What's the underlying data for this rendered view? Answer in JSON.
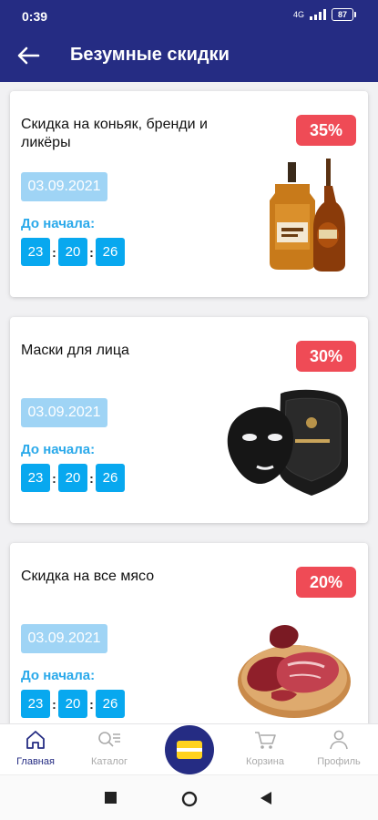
{
  "status": {
    "time": "0:39",
    "network": "4G",
    "battery": "87"
  },
  "header": {
    "title": "Безумные скидки"
  },
  "colors": {
    "primary": "#252c83",
    "badge": "#ef4b56",
    "timer": "#08a8ef",
    "date_bg": "#9fd4f5"
  },
  "cards": [
    {
      "name": "Скидка на коньяк, бренди и ликёры",
      "discount": "35%",
      "date": "03.09.2021",
      "countdown_label": "До начала:",
      "hours": "23",
      "minutes": "20",
      "seconds": "26",
      "image": "cognac-bottles-image"
    },
    {
      "name": "Маски для лица",
      "discount": "30%",
      "date": "03.09.2021",
      "countdown_label": "До начала:",
      "hours": "23",
      "minutes": "20",
      "seconds": "26",
      "image": "black-face-mask-image"
    },
    {
      "name": "Скидка на все мясо",
      "discount": "20%",
      "date": "03.09.2021",
      "countdown_label": "До начала:",
      "hours": "23",
      "minutes": "20",
      "seconds": "26",
      "image": "meat-board-image"
    }
  ],
  "nav": {
    "home": "Главная",
    "catalog": "Каталог",
    "cart": "Корзина",
    "profile": "Профиль"
  }
}
